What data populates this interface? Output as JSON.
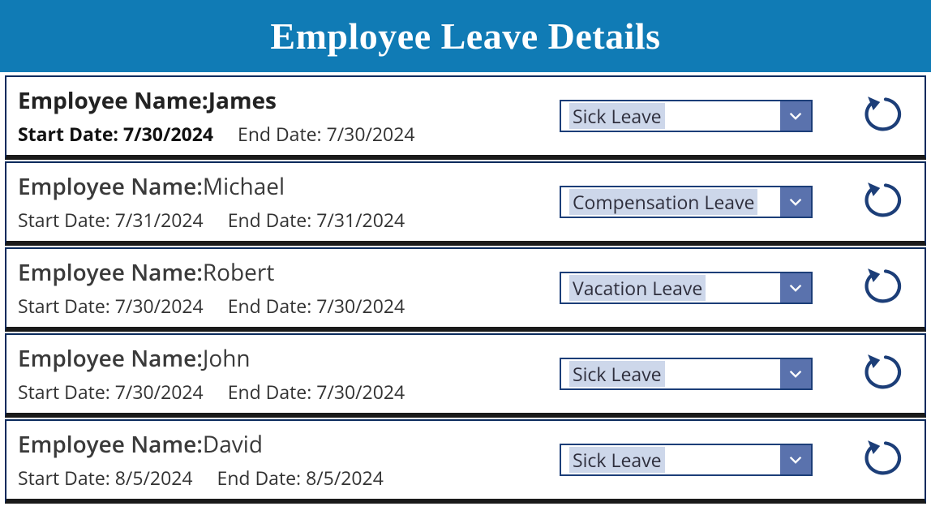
{
  "header": {
    "title": "Employee Leave Details"
  },
  "labels": {
    "employee_name": "Employee Name:",
    "start_date": "Start Date: ",
    "end_date": "End Date: "
  },
  "rows": [
    {
      "name": "James",
      "start_date": "7/30/2024",
      "end_date": "7/30/2024",
      "leave_type": "Sick Leave",
      "bold": true
    },
    {
      "name": "Michael",
      "start_date": "7/31/2024",
      "end_date": "7/31/2024",
      "leave_type": "Compensation Leave",
      "bold": false
    },
    {
      "name": "Robert",
      "start_date": "7/30/2024",
      "end_date": "7/30/2024",
      "leave_type": "Vacation Leave",
      "bold": false
    },
    {
      "name": "John",
      "start_date": "7/30/2024",
      "end_date": "7/30/2024",
      "leave_type": "Sick Leave",
      "bold": false
    },
    {
      "name": "David",
      "start_date": "8/5/2024",
      "end_date": "8/5/2024",
      "leave_type": "Sick Leave",
      "bold": false
    }
  ]
}
